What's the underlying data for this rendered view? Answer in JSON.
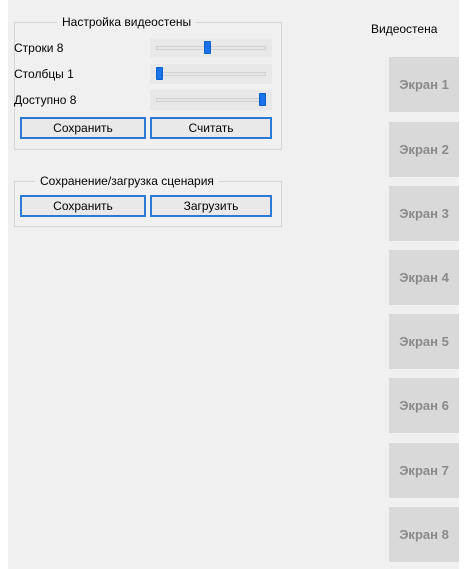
{
  "video_wall_settings": {
    "title": "Настройка видеостены",
    "rows": {
      "label": "Строки 8",
      "value": 8,
      "min": 1,
      "max": 16
    },
    "columns": {
      "label": "Столбцы 1",
      "value": 1,
      "min": 1,
      "max": 16
    },
    "available": {
      "label": "Доступно 8",
      "value": 8,
      "min": 1,
      "max": 8
    },
    "save_label": "Сохранить",
    "read_label": "Считать"
  },
  "scenario": {
    "title": "Сохранение/загрузка сценария",
    "save_label": "Сохранить",
    "load_label": "Загрузить"
  },
  "video_wall": {
    "title": "Видеостена",
    "screens": [
      "Экран 1",
      "Экран 2",
      "Экран 3",
      "Экран 4",
      "Экран 5",
      "Экран 6",
      "Экран 7",
      "Экран 8"
    ]
  }
}
